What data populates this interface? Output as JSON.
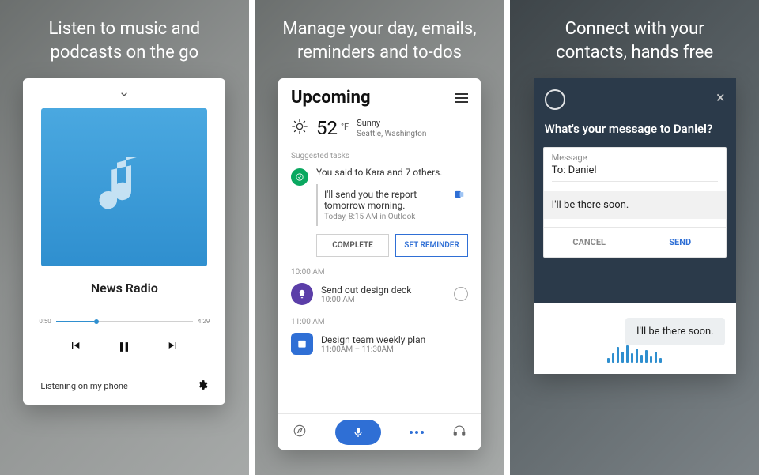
{
  "panel1": {
    "tagline": "Listen to music and\npodcasts on the go",
    "track_title": "News Radio",
    "progress_start": "0:50",
    "progress_end": "4:29",
    "listening_label": "Listening on my phone"
  },
  "panel2": {
    "tagline": "Manage your day, emails,\nreminders and to-dos",
    "heading": "Upcoming",
    "weather": {
      "temp": "52",
      "unit": "°F",
      "summary": "Sunny",
      "location": "Seattle, Washington"
    },
    "suggested_label": "Suggested tasks",
    "task": {
      "summary": "You said to Kara and 7 others.",
      "quote_text": "I'll send you the report tomorrow morning.",
      "quote_meta": "Today, 8:15 AM in Outlook",
      "complete_label": "COMPLETE",
      "reminder_label": "SET REMINDER"
    },
    "events": [
      {
        "time_header": "10:00 AM",
        "title": "Send out design deck",
        "sub": "10:00 AM"
      },
      {
        "time_header": "11:00 AM",
        "title": "Design team weekly plan",
        "sub": "11:00AM – 11:30AM"
      }
    ]
  },
  "panel3": {
    "tagline": "Connect with your\ncontacts, hands free",
    "prompt": "What's your message to Daniel?",
    "message_label": "Message",
    "to_line": "To: Daniel",
    "body": "I'll be there soon.",
    "cancel_label": "CANCEL",
    "send_label": "SEND",
    "chat_bubble": "I'll be there soon."
  }
}
